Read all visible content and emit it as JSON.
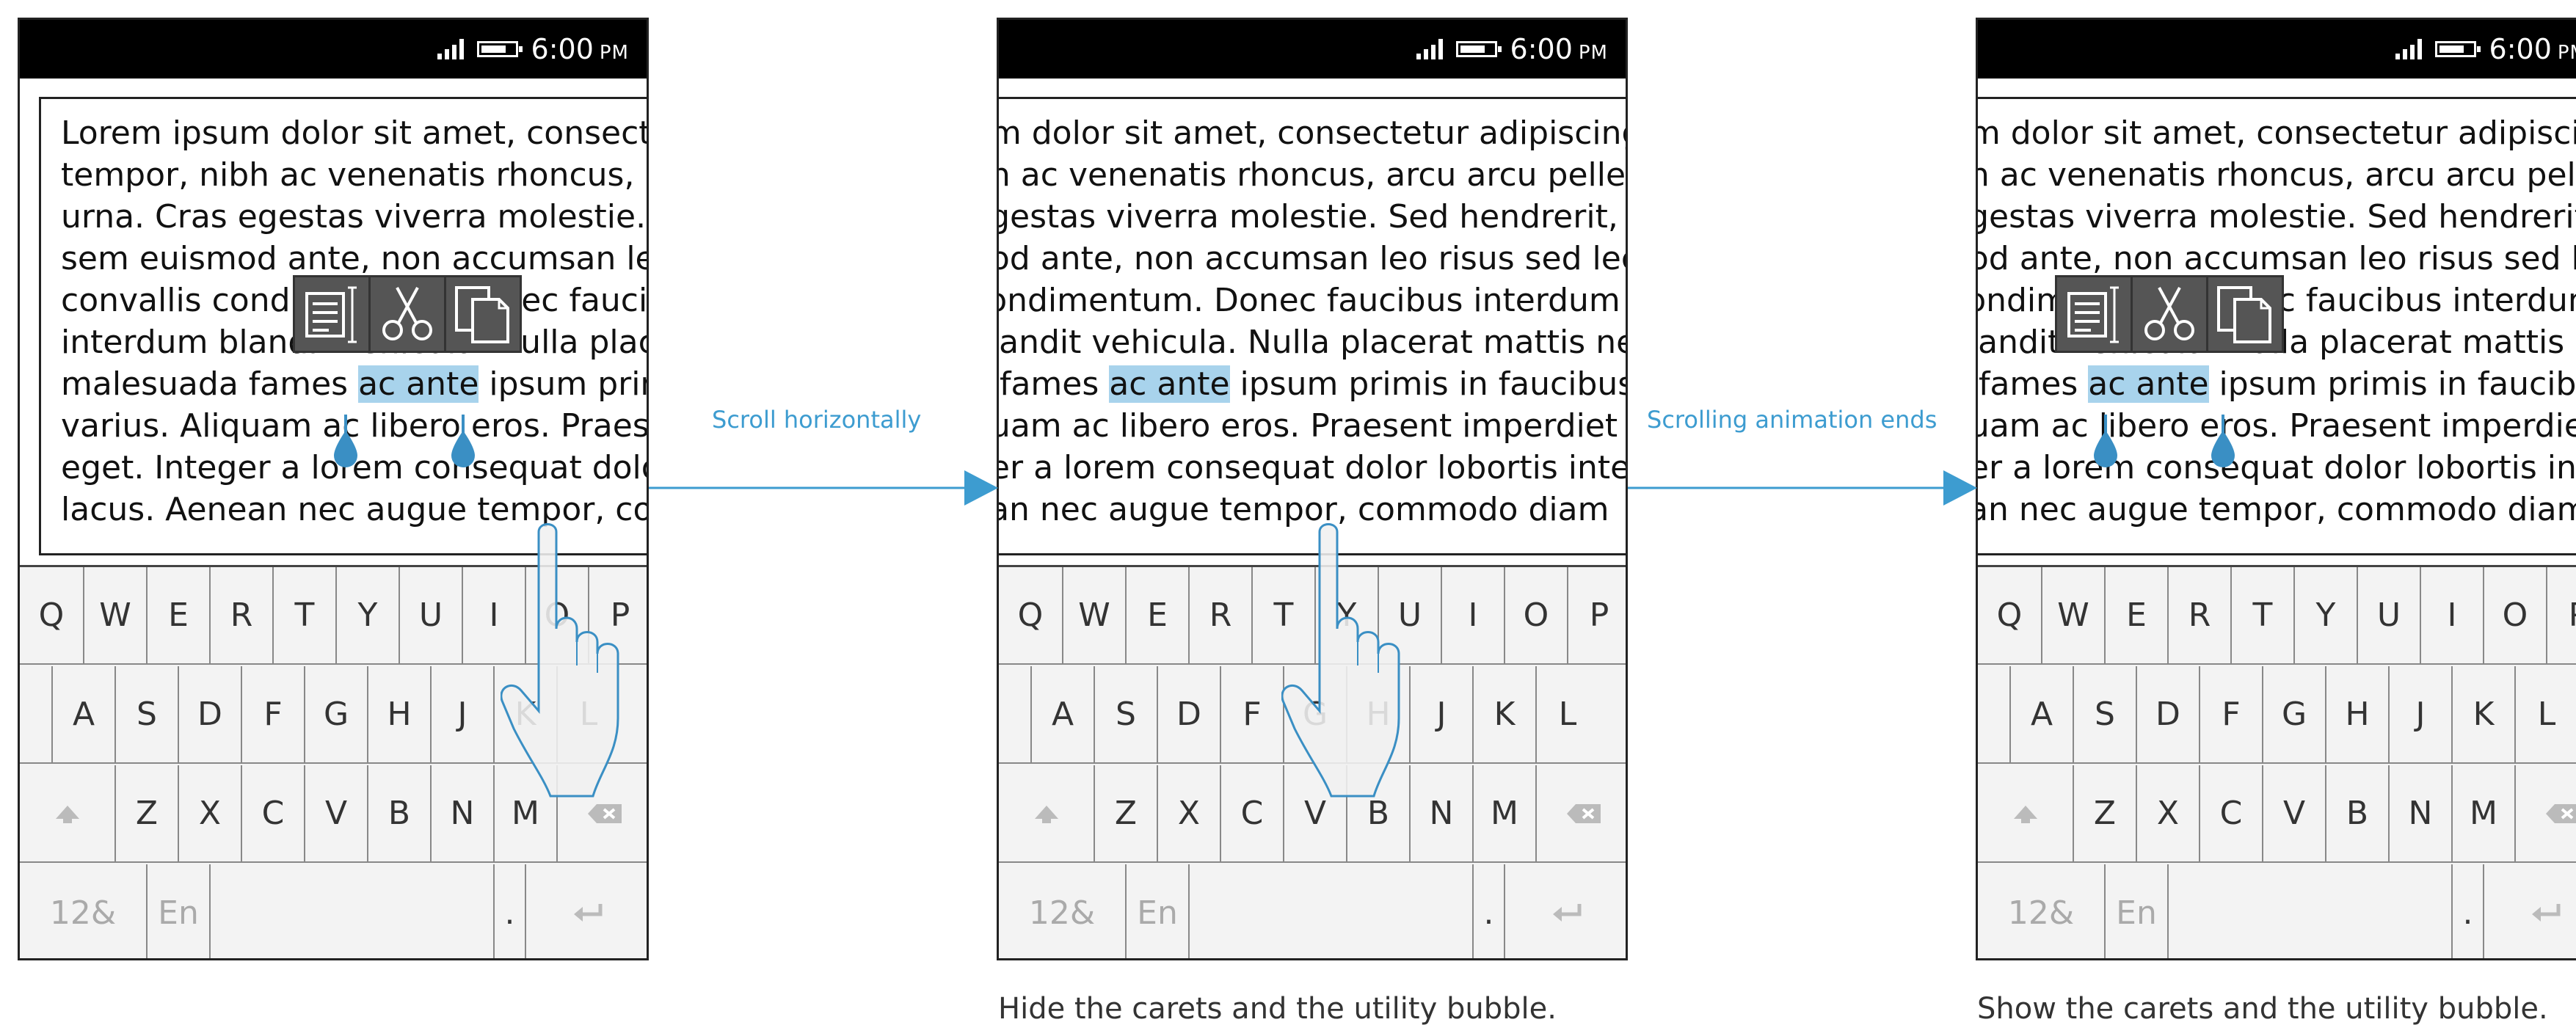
{
  "status": {
    "time": "6:00",
    "ampm": "PM"
  },
  "screens": [
    {
      "lines": [
        {
          "pre": "Lorem ipsum dolor sit amet, consectetur"
        },
        {
          "pre": "tempor, nibh ac venenatis rhoncus, arcu"
        },
        {
          "pre": "urna. Cras egestas viverra molestie. Sed"
        },
        {
          "pre": "sem euismod ante, non accumsan leo risus"
        },
        {
          "pre": "convallis condimentum. Donec faucibus"
        },
        {
          "pre": "interdum blandit vehicula. Nulla placerat"
        },
        {
          "pre": "malesuada fames ",
          "sel": "ac ante",
          "post": " ipsum primis"
        },
        {
          "pre": "varius. Aliquam ac libero eros. Praesent"
        },
        {
          "pre": "eget. Integer a lorem consequat dolor"
        },
        {
          "pre": "lacus. Aenean nec augue tempor, commodo"
        }
      ]
    },
    {
      "lines": [
        {
          "pre": "um dolor sit amet, consectetur adipiscing"
        },
        {
          "pre": "bh ac venenatis rhoncus, arcu arcu pellen"
        },
        {
          "pre": " egestas viverra molestie. Sed hendrerit,"
        },
        {
          "pre": "nod ante, non accumsan leo risus sed lec"
        },
        {
          "pre": "condimentum. Donec faucibus interdum"
        },
        {
          "pre": "blandit vehicula. Nulla placerat mattis ne"
        },
        {
          "pre": "a fames ",
          "sel": "ac ante",
          "post": " ipsum primis in faucibus"
        },
        {
          "pre": "quam ac libero eros. Praesent imperdiet"
        },
        {
          "pre": "ger a lorem consequat dolor lobortis inte"
        },
        {
          "pre": "ean nec augue tempor, commodo diam"
        }
      ]
    },
    {
      "lines": [
        {
          "pre": "um dolor sit amet, consectetur adipiscing"
        },
        {
          "pre": "bh ac venenatis rhoncus, arcu arcu pellen"
        },
        {
          "pre": " egestas viverra molestie. Sed hendrerit,"
        },
        {
          "pre": "nod ante, non accumsan leo risus sed lec"
        },
        {
          "pre": "condimentum. Donec faucibus interdum"
        },
        {
          "pre": "blandit vehicula. Nulla placerat mattis ne"
        },
        {
          "pre": "a fames ",
          "sel": "ac ante",
          "post": " ipsum primis in faucibus"
        },
        {
          "pre": "quam ac libero eros. Praesent imperdiet"
        },
        {
          "pre": "ger a lorem consequat dolor lobortis inte"
        },
        {
          "pre": "ean nec augue tempor, commodo diam"
        }
      ]
    }
  ],
  "keyboard": {
    "row1": [
      "Q",
      "W",
      "E",
      "R",
      "T",
      "Y",
      "U",
      "I",
      "O",
      "P"
    ],
    "row2": [
      "A",
      "S",
      "D",
      "F",
      "G",
      "H",
      "J",
      "K",
      "L"
    ],
    "row3": [
      "shift-icon",
      "Z",
      "X",
      "C",
      "V",
      "B",
      "N",
      "M",
      "backspace-icon"
    ],
    "row4": [
      "12&",
      "En",
      "space",
      "·",
      "enter-icon"
    ]
  },
  "utility_bubble": [
    "select-all-icon",
    "cut-icon",
    "copy-icon"
  ],
  "transitions": [
    "Scroll horizontally",
    "Scrolling animation ends"
  ],
  "captions": [
    "",
    "Hide the carets and the utility bubble.",
    "Show the carets and the utility bubble."
  ],
  "colors": {
    "accent": "#3d9cd0",
    "selection": "#a8d3ec",
    "toolbar": "#555555"
  }
}
